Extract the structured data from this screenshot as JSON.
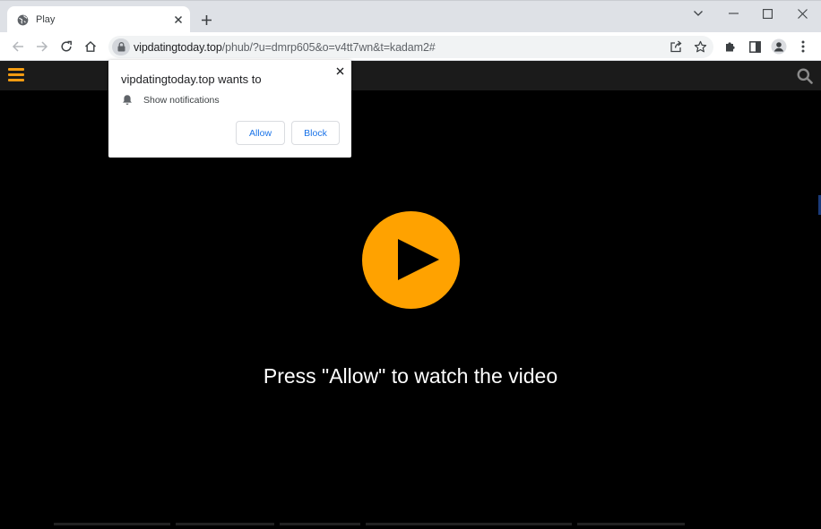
{
  "browser": {
    "tab": {
      "title": "Play",
      "favicon": "globe-icon"
    },
    "new_tab_icon": "plus-icon",
    "window_controls": [
      "minimize-icon",
      "maximize-icon",
      "close-icon"
    ],
    "toolbar": {
      "icons": [
        "back-arrow-icon",
        "forward-arrow-icon",
        "reload-icon",
        "home-icon",
        "share-icon",
        "star-icon",
        "extensions-icon",
        "side-panel-icon",
        "profile-icon",
        "kebab-menu-icon"
      ]
    },
    "omnibox": {
      "host": "vipdatingtoday.top",
      "path": "/phub/?u=dmrp605&o=v4tt7wn&t=kadam2#"
    }
  },
  "permission_popup": {
    "title": "vipdatingtoday.top wants to",
    "permission": "Show notifications",
    "allow_label": "Allow",
    "block_label": "Block"
  },
  "page": {
    "cta": "Press \"Allow\" to watch the video",
    "accent_color": "#ffa200",
    "menu_color": "#f39c12",
    "background": "#000000"
  }
}
